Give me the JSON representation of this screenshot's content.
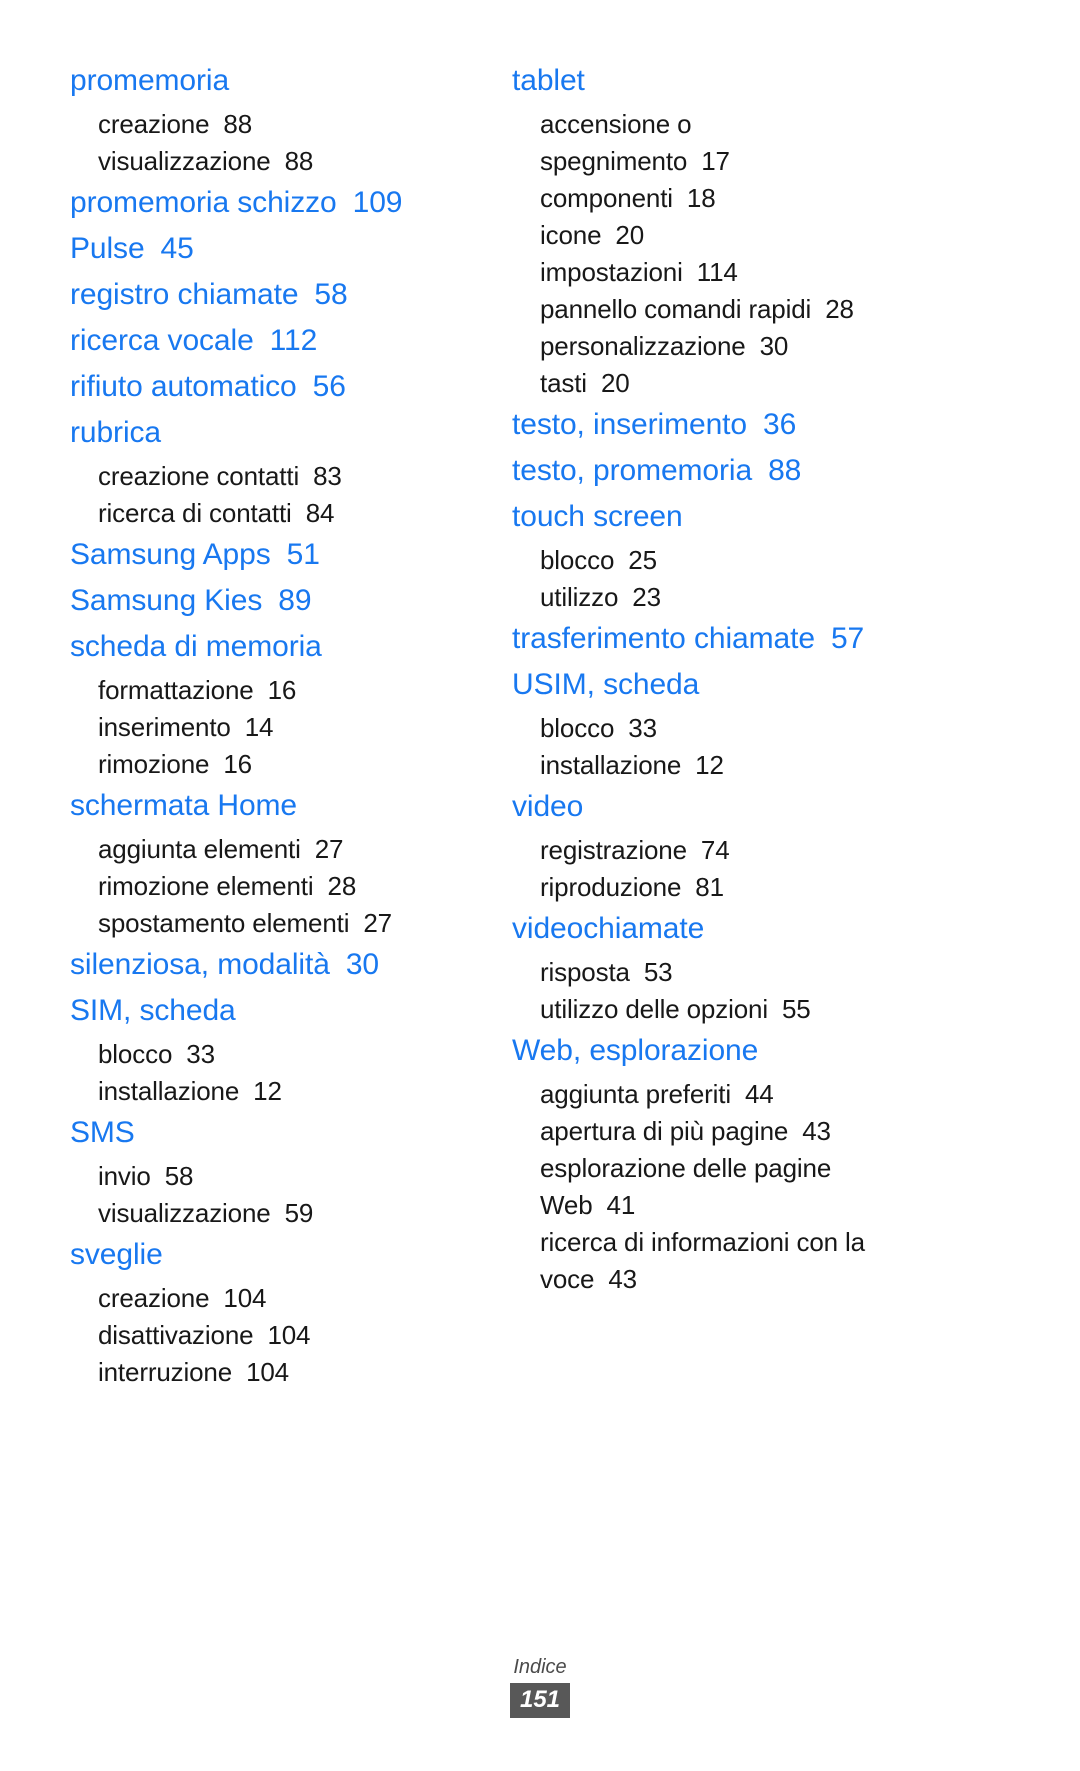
{
  "document": {
    "type": "index-page",
    "language": "it",
    "footer": {
      "label": "Indice",
      "page_number": "151"
    },
    "colors": {
      "heading": "#1878f0",
      "body": "#181818",
      "footer_badge_bg": "#585858",
      "background": "#ffffff"
    }
  },
  "left_column": [
    {
      "term": "promemoria",
      "page": "",
      "subs": [
        {
          "term": "creazione",
          "page": "88"
        },
        {
          "term": "visualizzazione",
          "page": "88"
        }
      ]
    },
    {
      "term": "promemoria schizzo",
      "page": "109",
      "subs": []
    },
    {
      "term": "Pulse",
      "page": "45",
      "subs": []
    },
    {
      "term": "registro chiamate",
      "page": "58",
      "subs": []
    },
    {
      "term": "ricerca vocale",
      "page": "112",
      "subs": []
    },
    {
      "term": "rifiuto automatico",
      "page": "56",
      "subs": []
    },
    {
      "term": "rubrica",
      "page": "",
      "subs": [
        {
          "term": "creazione contatti",
          "page": "83"
        },
        {
          "term": "ricerca di contatti",
          "page": "84"
        }
      ]
    },
    {
      "term": "Samsung Apps",
      "page": "51",
      "subs": []
    },
    {
      "term": "Samsung Kies",
      "page": "89",
      "subs": []
    },
    {
      "term": "scheda di memoria",
      "page": "",
      "subs": [
        {
          "term": "formattazione",
          "page": "16"
        },
        {
          "term": "inserimento",
          "page": "14"
        },
        {
          "term": "rimozione",
          "page": "16"
        }
      ]
    },
    {
      "term": "schermata Home",
      "page": "",
      "subs": [
        {
          "term": "aggiunta elementi",
          "page": "27"
        },
        {
          "term": "rimozione elementi",
          "page": "28"
        },
        {
          "term": "spostamento elementi",
          "page": "27"
        }
      ]
    },
    {
      "term": "silenziosa, modalità",
      "page": "30",
      "subs": []
    },
    {
      "term": "SIM, scheda",
      "page": "",
      "subs": [
        {
          "term": "blocco",
          "page": "33"
        },
        {
          "term": "installazione",
          "page": "12"
        }
      ]
    },
    {
      "term": "SMS",
      "page": "",
      "subs": [
        {
          "term": "invio",
          "page": "58"
        },
        {
          "term": "visualizzazione",
          "page": "59"
        }
      ]
    },
    {
      "term": "sveglie",
      "page": "",
      "subs": [
        {
          "term": "creazione",
          "page": "104"
        },
        {
          "term": "disattivazione",
          "page": "104"
        },
        {
          "term": "interruzione",
          "page": "104"
        }
      ]
    }
  ],
  "right_column": [
    {
      "term": "tablet",
      "page": "",
      "subs": [
        {
          "term": "accensione o",
          "page": "",
          "continuation": "spegnimento",
          "continuation_page": "17"
        },
        {
          "term": "componenti",
          "page": "18"
        },
        {
          "term": "icone",
          "page": "20"
        },
        {
          "term": "impostazioni",
          "page": "114"
        },
        {
          "term": "pannello comandi rapidi",
          "page": "28"
        },
        {
          "term": "personalizzazione",
          "page": "30"
        },
        {
          "term": "tasti",
          "page": "20"
        }
      ]
    },
    {
      "term": "testo, inserimento",
      "page": "36",
      "subs": []
    },
    {
      "term": "testo, promemoria",
      "page": "88",
      "subs": []
    },
    {
      "term": "touch screen",
      "page": "",
      "subs": [
        {
          "term": "blocco",
          "page": "25"
        },
        {
          "term": "utilizzo",
          "page": "23"
        }
      ]
    },
    {
      "term": "trasferimento chiamate",
      "page": "57",
      "subs": []
    },
    {
      "term": "USIM, scheda",
      "page": "",
      "subs": [
        {
          "term": "blocco",
          "page": "33"
        },
        {
          "term": "installazione",
          "page": "12"
        }
      ]
    },
    {
      "term": "video",
      "page": "",
      "subs": [
        {
          "term": "registrazione",
          "page": "74"
        },
        {
          "term": "riproduzione",
          "page": "81"
        }
      ]
    },
    {
      "term": "videochiamate",
      "page": "",
      "subs": [
        {
          "term": "risposta",
          "page": "53"
        },
        {
          "term": "utilizzo delle opzioni",
          "page": "55"
        }
      ]
    },
    {
      "term": "Web, esplorazione",
      "page": "",
      "subs": [
        {
          "term": "aggiunta preferiti",
          "page": "44"
        },
        {
          "term": "apertura di più pagine",
          "page": "43"
        },
        {
          "term": "esplorazione delle pagine",
          "page": "",
          "continuation": "Web",
          "continuation_page": "41"
        },
        {
          "term": "ricerca di informazioni con la",
          "page": "",
          "continuation": "voce",
          "continuation_page": "43"
        }
      ]
    }
  ]
}
